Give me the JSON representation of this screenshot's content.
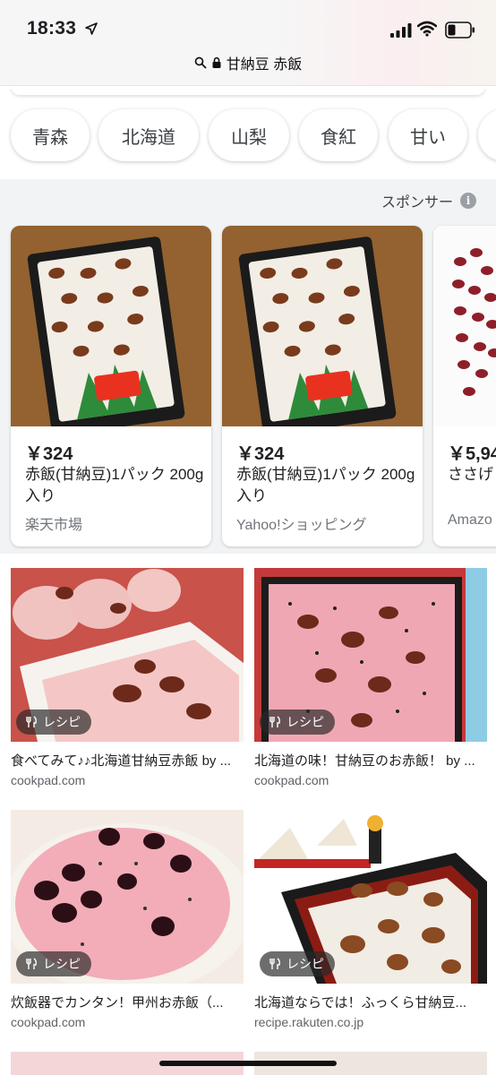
{
  "status_bar": {
    "time": "18:33"
  },
  "url_bar": {
    "query": "甘納豆 赤飯"
  },
  "chips": [
    "青森",
    "北海道",
    "山梨",
    "食紅",
    "甘い"
  ],
  "sponsored": {
    "label": "スポンサー",
    "info_glyph": "i",
    "products": [
      {
        "price": "￥324",
        "title": "赤飯(甘納豆)1パック 200g入り",
        "store": "楽天市場"
      },
      {
        "price": "￥324",
        "title": "赤飯(甘納豆)1パック 200g入り",
        "store": "Yahoo!ショッピング"
      },
      {
        "price": "￥5,94",
        "title": "ささげ ルマさ",
        "store": "Amazo"
      }
    ]
  },
  "recipes": [
    {
      "badge": "レシピ",
      "title": "食べてみて♪♪北海道甘納豆赤飯 by ...",
      "source": "cookpad.com"
    },
    {
      "badge": "レシピ",
      "title": "北海道の味！甘納豆のお赤飯！ by ...",
      "source": "cookpad.com"
    },
    {
      "badge": "レシピ",
      "title": "炊飯器でカンタン！甲州お赤飯（...",
      "source": "cookpad.com"
    },
    {
      "badge": "レシピ",
      "title": "北海道ならでは！ふっくら甘納豆...",
      "source": "recipe.rakuten.co.jp"
    }
  ],
  "colors": {
    "accent_red": "#e53935",
    "rice_pink": "#f3b8c0",
    "bean": "#7a2e1f",
    "tray": "#1c1c1c"
  }
}
